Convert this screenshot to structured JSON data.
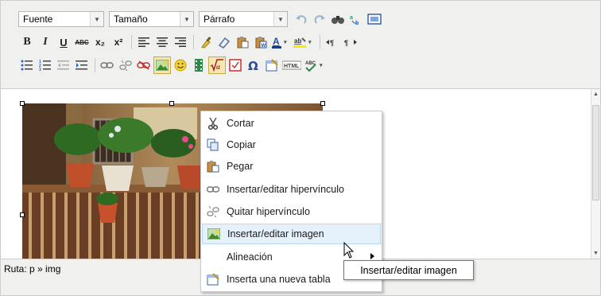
{
  "toolbar": {
    "font_select": "Fuente",
    "size_select": "Tamaño",
    "format_select": "Párrafo",
    "bold": "B",
    "italic": "I",
    "underline": "U",
    "strike": "ABC",
    "subscript": "x₂",
    "superscript": "x²",
    "html": "HTML"
  },
  "statusbar": {
    "path": "Ruta: p » img"
  },
  "context_menu": {
    "items": [
      {
        "label": "Cortar",
        "icon": "scissors-icon"
      },
      {
        "label": "Copiar",
        "icon": "copy-icon"
      },
      {
        "label": "Pegar",
        "icon": "paste-icon"
      },
      {
        "label": "Insertar/editar hipervínculo",
        "icon": "link-icon"
      },
      {
        "label": "Quitar hipervínculo",
        "icon": "unlink-icon"
      },
      {
        "label": "Insertar/editar imagen",
        "icon": "image-icon"
      },
      {
        "label": "Alineación",
        "icon": ""
      },
      {
        "label": "Inserta una nueva tabla",
        "icon": "table-icon"
      }
    ]
  },
  "tooltip": "Insertar/editar imagen"
}
